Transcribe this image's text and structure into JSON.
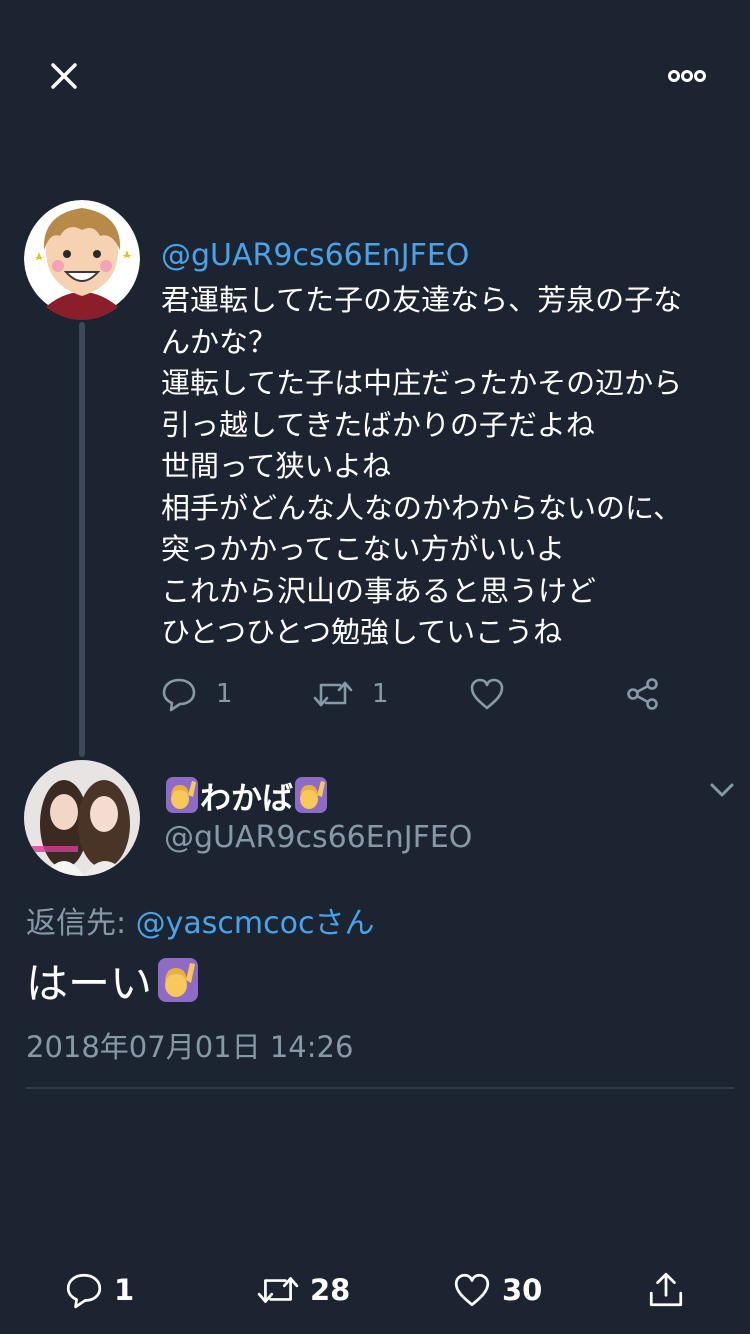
{
  "parent_tweet": {
    "handle": "@gUAR9cs66EnJFEO",
    "text_lines": [
      "君運転してた子の友達なら、芳泉の子な",
      "んかな？",
      "運転してた子は中庄だったかその辺から",
      "引っ越してきたばかりの子だよね",
      "世間って狭いよね",
      "相手がどんな人なのかわからないのに、",
      "突っかかってこない方がいいよ",
      "これから沢山の事あると思うけど",
      "ひとつひとつ勉強していこうね"
    ],
    "reply_count": "1",
    "retweet_count": "1",
    "like_count": "",
    "icons": [
      "reply-icon",
      "retweet-icon",
      "like-icon",
      "share-icon"
    ]
  },
  "main_tweet": {
    "display_name": "わかば",
    "name_emoji": "🙋‍♀️",
    "handle": "@gUAR9cs66EnJFEO",
    "reply_label": "返信先: ",
    "reply_mention": "@yascmcoc",
    "reply_suffix": "さん",
    "text": "はーい",
    "text_emoji": "🙋‍♀️",
    "timestamp": "2018年07月01日 14:26"
  },
  "bottom_bar": {
    "reply_count": "1",
    "retweet_count": "28",
    "like_count": "30"
  },
  "colors": {
    "background": "#1c2432",
    "link": "#4aa3e8",
    "secondary": "#8899a6",
    "thread_line": "#3c4958"
  }
}
